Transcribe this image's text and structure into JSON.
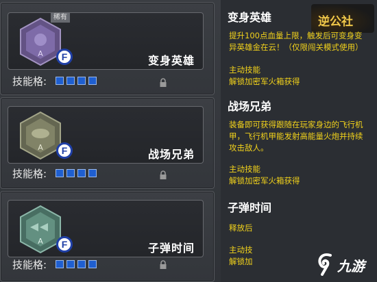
{
  "skill_cards": [
    {
      "name": "变身英雄",
      "badge": "F",
      "slot_label": "技能格:",
      "rare_tag": "稀有",
      "emblem_color": "#8a6fb4",
      "emblem_icon": "hero-emblem-icon"
    },
    {
      "name": "战场兄弟",
      "badge": "F",
      "slot_label": "技能格:",
      "rare_tag": "",
      "emblem_color": "#8d9070",
      "emblem_icon": "drone-emblem-icon"
    },
    {
      "name": "子弹时间",
      "badge": "F",
      "slot_label": "技能格:",
      "rare_tag": "",
      "emblem_color": "#6f9f8e",
      "emblem_icon": "bullet-time-emblem-icon"
    }
  ],
  "details": [
    {
      "title": "变身英雄",
      "desc_lines": [
        "提升100点血量上限，触发后可变身变",
        "异英雄金在云！（仅限闯关模式使用）"
      ],
      "type": "主动技能",
      "source": "解锁加密军火箱获得"
    },
    {
      "title": "战场兄弟",
      "desc_lines": [
        "装备即可获得跟随在玩家身边的飞行机",
        "甲，飞行机甲能发射高能量火炮并持续",
        "攻击敌人。"
      ],
      "type": "主动技能",
      "source": "解锁加密军火箱获得"
    },
    {
      "title": "子弹时间",
      "desc_lines": [
        "释放后"
      ],
      "type": "主动技",
      "source": "解锁加"
    }
  ],
  "logos": {
    "top_text": "逆公社",
    "bottom_text": "九游"
  },
  "colors": {
    "accent_yellow": "#f2d21b",
    "slot_blue": "#1f5fd0",
    "badge_blue": "#1f3fa6"
  }
}
